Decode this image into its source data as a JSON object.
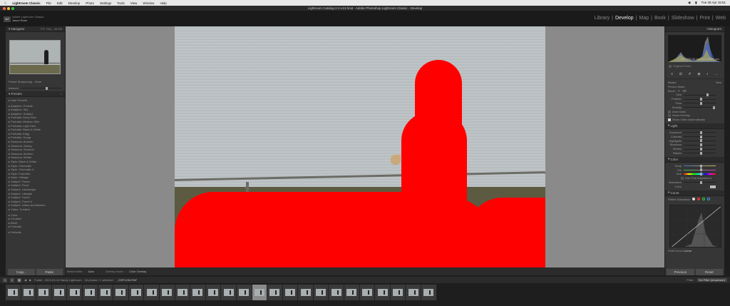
{
  "menubar": {
    "apple": "",
    "app_name": "Lightroom Classic",
    "items": [
      "File",
      "Edit",
      "Develop",
      "Photo",
      "Settings",
      "Tools",
      "View",
      "Window",
      "Help"
    ],
    "clock": "Tue 28 Apr 15:51"
  },
  "window": {
    "title": "Lightroom Catalog-2-2-v13.lrcat - Adobe Photoshop Lightroom Classic - Develop",
    "colors": {
      "close": "#ff5f57",
      "minimize": "#febc2e",
      "zoom": "#28c840"
    }
  },
  "identity": {
    "logo": "Lr",
    "line1": "Adobe Lightroom Classic",
    "user": "Jason Rose"
  },
  "modules": {
    "items": [
      "Library",
      "Develop",
      "Map",
      "Book",
      "Slideshow",
      "Print",
      "Web"
    ],
    "active": "Develop",
    "sep": "|"
  },
  "navigator": {
    "title": "Navigator",
    "zoom_fit": "FIT",
    "zoom_fill": "FILL",
    "zoom_pct": "33.3%",
    "preset_label": "Preset",
    "preset_value": "Sharpening - None",
    "amount_label": "Amount"
  },
  "presets": {
    "title": "Presets",
    "items": [
      "User Presets",
      "Adaptive: Portrait",
      "Adaptive: Sky",
      "Adaptive: Subject",
      "Portraits: Deep Skin",
      "Portraits: Medium Skin",
      "Portraits: Light Skin",
      "Portraits: Black & White",
      "Portraits: Edgy",
      "Portraits: Group",
      "Seasons: Autumn",
      "Seasons: Spring",
      "Seasons: Summer",
      "Seasons: Autumn",
      "Seasons: Winter",
      "Style: Black & White",
      "Style: Cinematic",
      "Style: Cinematic II",
      "Style: Futuristic",
      "Style: Vintage",
      "Subject: Travel",
      "Subject: Food",
      "Subject: Landscape",
      "Subject: Lifestyle",
      "Subject: Travel",
      "Subject: Travel II",
      "Subject: Urban Architecture",
      "Video: Creative"
    ],
    "groups": [
      "Color",
      "Creative",
      "B&W",
      "Portraits",
      "Defaults"
    ]
  },
  "left_buttons": {
    "copy": "Copy...",
    "paste": "Paste"
  },
  "toolbar": {
    "before_after_label": "Before/After :",
    "before_after_value": "Auto",
    "overlay_label": "Overlay mode :",
    "overlay_value": "Color Overlay"
  },
  "histogram": {
    "title": "Histogram",
    "readout": "ISO 250   32 mm   f/4   1/2500 sec",
    "original_photo": "Original Photo"
  },
  "masking": {
    "title": "Masks",
    "mask_label": "Person Mask",
    "new_label": "New",
    "brush_label": "Brush",
    "size_label": "Size",
    "feather_label": "Feather",
    "flow_label": "Flow",
    "density_label": "Density",
    "auto_mask_label": "Auto Mask",
    "show_overlay": "Show Overlay",
    "show_video": "Show Video Automatically"
  },
  "light": {
    "title": "Light",
    "sliders": [
      {
        "label": "Exposure",
        "value": 0.5
      },
      {
        "label": "Contrast",
        "value": 0.5
      },
      {
        "label": "Highlights",
        "value": 0.5
      },
      {
        "label": "Shadows",
        "value": 0.5
      },
      {
        "label": "Whites",
        "value": 0.5
      },
      {
        "label": "Blacks",
        "value": 0.5
      }
    ]
  },
  "color": {
    "title": "Color",
    "sliders": [
      {
        "label": "Temp",
        "value": 0.5
      },
      {
        "label": "Tint",
        "value": 0.5
      },
      {
        "label": "Hue",
        "value": 0.5
      }
    ],
    "use_fine": "Use Fine Adjustment",
    "saturation_label": "Saturation",
    "color_label": "Color"
  },
  "curve": {
    "title": "Curve",
    "refine_label": "Refine Saturation",
    "point_curve_label": "Point Curve",
    "point_curve_value": "Linear"
  },
  "right_buttons": {
    "previous": "Previous",
    "reset": "Reset"
  },
  "filmstrip_bar": {
    "source": "Folder : 2023-03-14 Sandy Lightroom",
    "count": "34 photos / 1 selected /",
    "filename": "_DSF1234.RAF",
    "filter_label": "Filter :",
    "filter_value": "No Filter (dropdown)"
  },
  "filmstrip": {
    "count": 28,
    "selected_index": 16
  }
}
